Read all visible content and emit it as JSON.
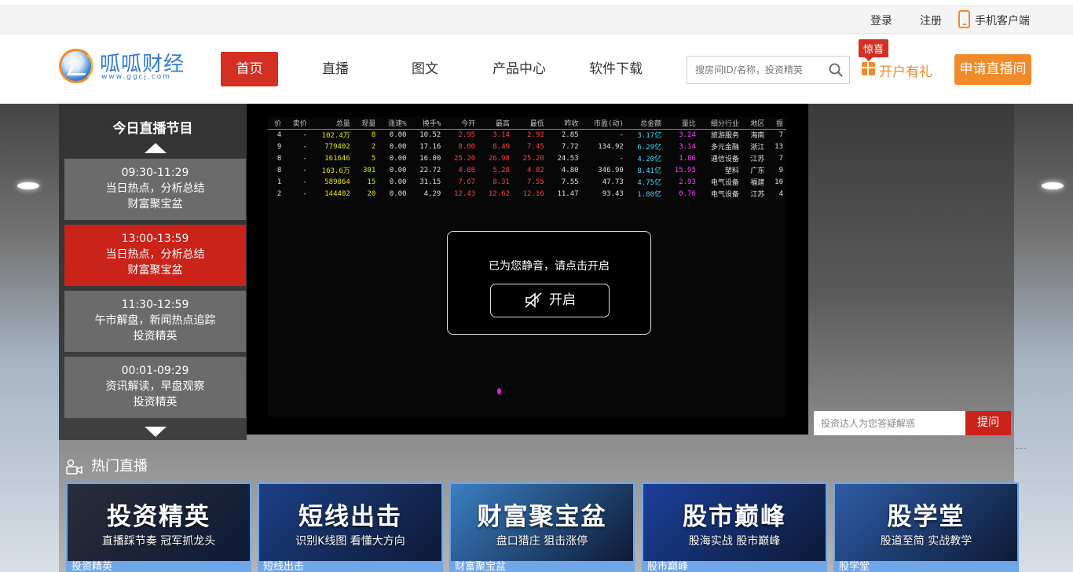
{
  "topbar": {
    "login": "登录",
    "register": "注册",
    "mobile_client": "手机客户端"
  },
  "header": {
    "logo_name": "呱呱财经",
    "logo_url_text": "www.ggcj.com",
    "nav": [
      {
        "label": "首页",
        "active": true
      },
      {
        "label": "直播",
        "active": false
      },
      {
        "label": "图文",
        "active": false
      },
      {
        "label": "产品中心",
        "active": false
      },
      {
        "label": "软件下载",
        "active": false
      }
    ],
    "search_placeholder": "搜房间ID/名称，投资精英",
    "promo_badge": "惊喜",
    "promo_text": "开户有礼",
    "apply_button": "申请直播间"
  },
  "schedule": {
    "title": "今日直播节目",
    "slots": [
      {
        "time": "09:30-11:29",
        "topic": "当日热点，分析总结",
        "host": "财富聚宝盆",
        "active": false
      },
      {
        "time": "13:00-13:59",
        "topic": "当日热点，分析总结",
        "host": "财富聚宝盆",
        "active": true
      },
      {
        "time": "11:30-12:59",
        "topic": "午市解盘，新闻热点追踪",
        "host": "投资精英",
        "active": false
      },
      {
        "time": "00:01-09:29",
        "topic": "资讯解读，早盘观察",
        "host": "投资精英",
        "active": false
      }
    ]
  },
  "player": {
    "mute_notice": "已为您静音，请点击开启",
    "unmute_button": "开启",
    "quote_headers": [
      "价",
      "卖价",
      "总量",
      "现量",
      "涨速%",
      "换手%",
      "今开",
      "最高",
      "最低",
      "昨收",
      "市盈(动)",
      "总金额",
      "量比",
      "细分行业",
      "地区",
      "振"
    ],
    "quote_rows": [
      [
        "4",
        "-",
        "102.4万",
        "8",
        "0.00",
        "10.52",
        "2.95",
        "3.14",
        "2.92",
        "2.85",
        "-",
        "3.17亿",
        "3.24",
        "旅游服务",
        "海南",
        "7"
      ],
      [
        "9",
        "-",
        "779402",
        "2",
        "0.00",
        "17.16",
        "8.00",
        "8.49",
        "7.45",
        "7.72",
        "134.92",
        "6.29亿",
        "3.14",
        "多元金融",
        "浙江",
        "13"
      ],
      [
        "8",
        "-",
        "161646",
        "5",
        "0.00",
        "16.00",
        "25.20",
        "26.98",
        "25.20",
        "24.53",
        "-",
        "4.20亿",
        "1.86",
        "通信设备",
        "江苏",
        "7"
      ],
      [
        "8",
        "-",
        "163.6万",
        "301",
        "0.00",
        "22.72",
        "4.88",
        "5.28",
        "4.82",
        "4.80",
        "346.90",
        "8.41亿",
        "15.95",
        "塑料",
        "广东",
        "9"
      ],
      [
        "1",
        "-",
        "589864",
        "15",
        "0.00",
        "31.15",
        "7.67",
        "8.31",
        "7.55",
        "7.55",
        "47.73",
        "4.75亿",
        "2.93",
        "电气设备",
        "福建",
        "10"
      ],
      [
        "2",
        "-",
        "144402",
        "20",
        "0.00",
        "4.29",
        "12.43",
        "12.62",
        "12.16",
        "11.47",
        "93.43",
        "1.80亿",
        "0.76",
        "电气设备",
        "江苏",
        "4"
      ]
    ]
  },
  "qa": {
    "placeholder": "投资达人为您答疑解惑",
    "button": "提问"
  },
  "hot": {
    "title": "热门直播",
    "cards": [
      {
        "big": "投资精英",
        "small": "直播踩节奏 冠军抓龙头",
        "caption": "投资精英",
        "color": "#2a2d3a"
      },
      {
        "big": "短线出击",
        "small": "识别K线图 看懂大方向",
        "caption": "短线出击",
        "color": "#1d3f86"
      },
      {
        "big": "财富聚宝盆",
        "small": "盘口猎庄 狙击涨停",
        "caption": "财富聚宝盆",
        "color": "#3b7fc2"
      },
      {
        "big": "股市巅峰",
        "small": "股海实战 股市巅峰",
        "caption": "股市巅峰",
        "color": "#1b3f9a"
      },
      {
        "big": "股学堂",
        "small": "股道至简 实战教学",
        "caption": "股学堂",
        "color": "#2e5da6"
      }
    ]
  },
  "colors": {
    "brand_red": "#d32f23",
    "brand_orange": "#f08a2a",
    "brand_blue": "#2f7bd8"
  }
}
